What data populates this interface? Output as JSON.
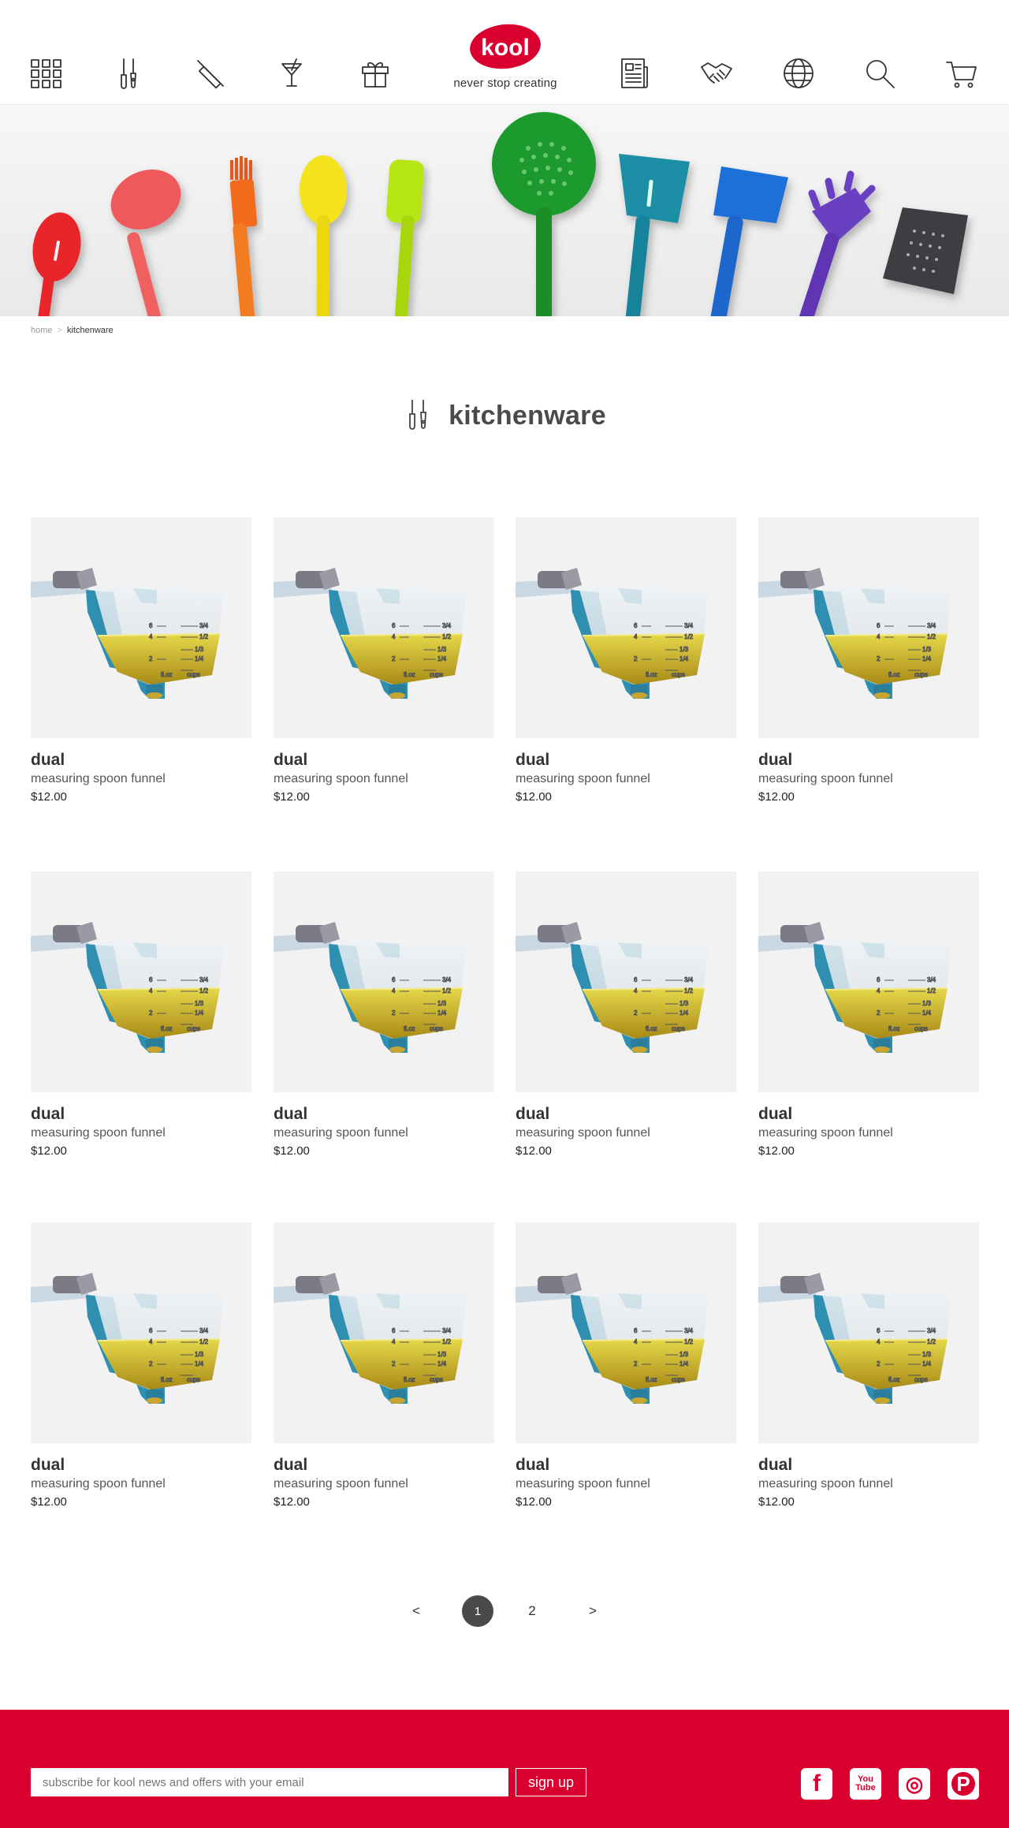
{
  "header": {
    "logo_text": "kool",
    "tagline": "never stop creating",
    "left_nav": [
      {
        "icon": "grid-icon",
        "label": "all categories"
      },
      {
        "icon": "utensils-icon",
        "label": "kitchenware"
      },
      {
        "icon": "rolling-pin-icon",
        "label": "baking"
      },
      {
        "icon": "cocktail-icon",
        "label": "bar"
      },
      {
        "icon": "gift-icon",
        "label": "gifts"
      }
    ],
    "right_nav": [
      {
        "icon": "newspaper-icon",
        "label": "news"
      },
      {
        "icon": "handshake-icon",
        "label": "partners"
      },
      {
        "icon": "globe-icon",
        "label": "language"
      },
      {
        "icon": "search-icon",
        "label": "search"
      },
      {
        "icon": "cart-icon",
        "label": "cart"
      }
    ]
  },
  "breadcrumb": {
    "home": "home",
    "separator": ">",
    "current": "kitchenware"
  },
  "page": {
    "title": "kitchenware",
    "title_icon": "utensils-icon"
  },
  "products": [
    {
      "name": "dual",
      "description": "measuring spoon funnel",
      "price": "$12.00"
    },
    {
      "name": "dual",
      "description": "measuring spoon funnel",
      "price": "$12.00"
    },
    {
      "name": "dual",
      "description": "measuring spoon funnel",
      "price": "$12.00"
    },
    {
      "name": "dual",
      "description": "measuring spoon funnel",
      "price": "$12.00"
    },
    {
      "name": "dual",
      "description": "measuring spoon funnel",
      "price": "$12.00"
    },
    {
      "name": "dual",
      "description": "measuring spoon funnel",
      "price": "$12.00"
    },
    {
      "name": "dual",
      "description": "measuring spoon funnel",
      "price": "$12.00"
    },
    {
      "name": "dual",
      "description": "measuring spoon funnel",
      "price": "$12.00"
    },
    {
      "name": "dual",
      "description": "measuring spoon funnel",
      "price": "$12.00"
    },
    {
      "name": "dual",
      "description": "measuring spoon funnel",
      "price": "$12.00"
    },
    {
      "name": "dual",
      "description": "measuring spoon funnel",
      "price": "$12.00"
    },
    {
      "name": "dual",
      "description": "measuring spoon funnel",
      "price": "$12.00"
    }
  ],
  "pagination": {
    "prev": "<",
    "pages": [
      "1",
      "2"
    ],
    "current": "1",
    "next": ">"
  },
  "footer": {
    "subscribe_placeholder": "subscribe for kool news and offers with your email",
    "signup_label": "sign up",
    "social": [
      {
        "icon": "facebook-icon",
        "glyph": "f"
      },
      {
        "icon": "youtube-icon",
        "glyph": "You Tube"
      },
      {
        "icon": "instagram-icon",
        "glyph": "◎"
      },
      {
        "icon": "pinterest-icon",
        "glyph": "P"
      }
    ]
  },
  "colors": {
    "brand_red": "#d9002f",
    "product_bg": "#f2f2f2",
    "text_dark": "#333333"
  }
}
